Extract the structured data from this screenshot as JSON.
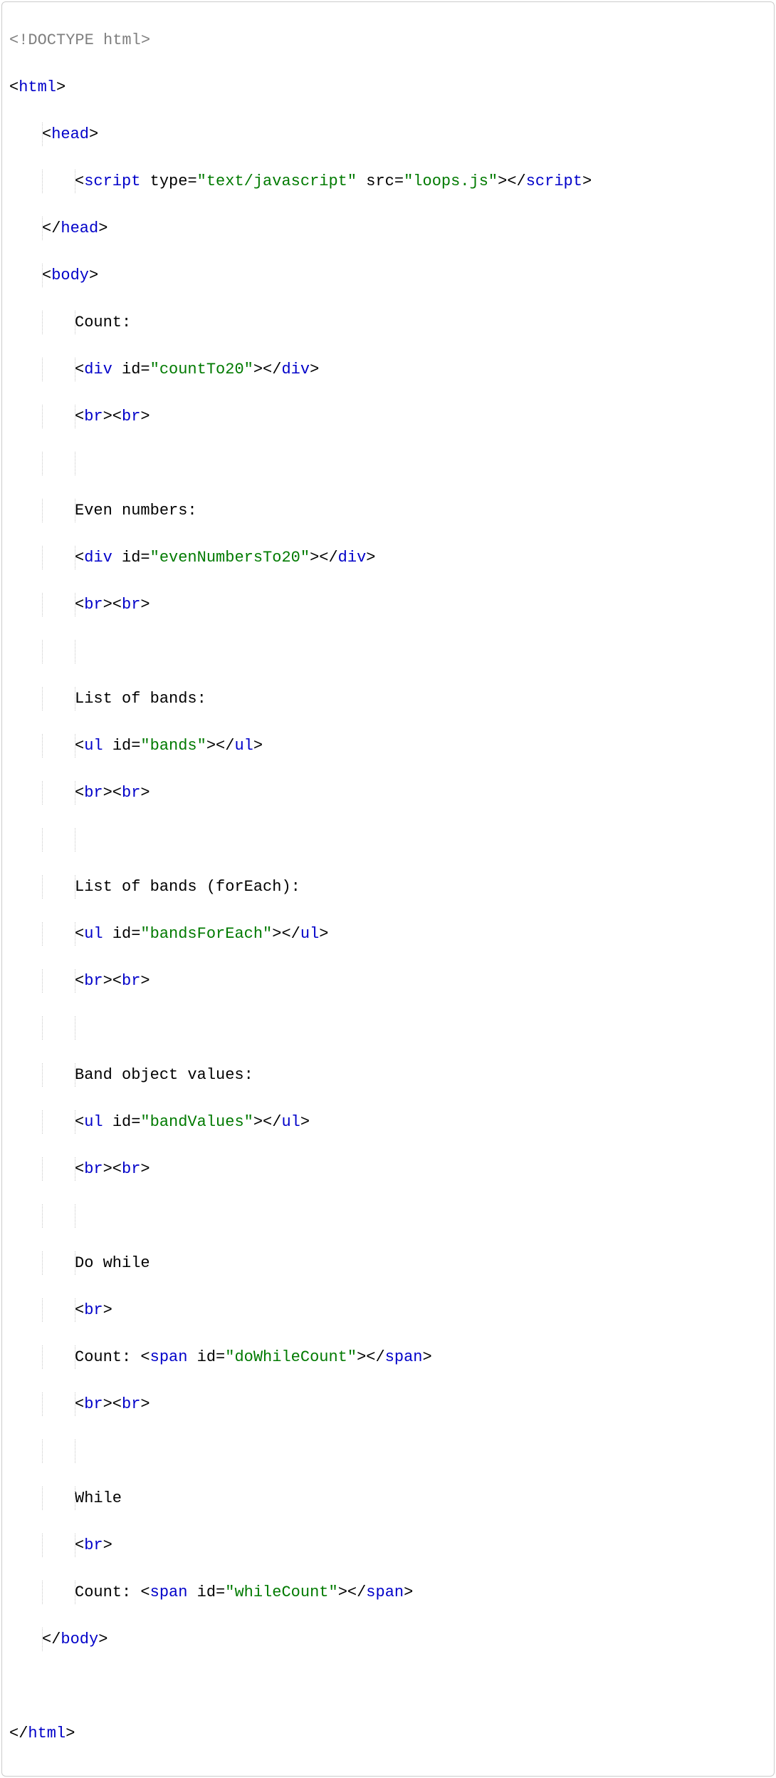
{
  "code": {
    "l00_doctype": "<!DOCTYPE html>",
    "l01_open_html_p1": "<",
    "l01_open_html_tag": "html",
    "l01_open_html_p2": ">",
    "l02_open_head_p1": "<",
    "l02_open_head_tag": "head",
    "l02_open_head_p2": ">",
    "l03_script_p1": "<",
    "l03_script_tag1": "script",
    "l03_script_sp1": " ",
    "l03_script_attr1": "type",
    "l03_script_eq1": "=",
    "l03_script_val1": "\"text/javascript\"",
    "l03_script_sp2": " ",
    "l03_script_attr2": "src",
    "l03_script_eq2": "=",
    "l03_script_val2": "\"loops.js\"",
    "l03_script_p2": "></",
    "l03_script_tag2": "script",
    "l03_script_p3": ">",
    "l04_close_head_p1": "</",
    "l04_close_head_tag": "head",
    "l04_close_head_p2": ">",
    "l05_open_body_p1": "<",
    "l05_open_body_tag": "body",
    "l05_open_body_p2": ">",
    "l06_text": "Count:",
    "l07_p1": "<",
    "l07_tag1": "div",
    "l07_sp1": " ",
    "l07_attr1": "id",
    "l07_eq1": "=",
    "l07_val1": "\"countTo20\"",
    "l07_p2": "></",
    "l07_tag2": "div",
    "l07_p3": ">",
    "l08_p1": "<",
    "l08_tag1": "br",
    "l08_p2": "><",
    "l08_tag2": "br",
    "l08_p3": ">",
    "l10_text": "Even numbers:",
    "l11_p1": "<",
    "l11_tag1": "div",
    "l11_sp1": " ",
    "l11_attr1": "id",
    "l11_eq1": "=",
    "l11_val1": "\"evenNumbersTo20\"",
    "l11_p2": "></",
    "l11_tag2": "div",
    "l11_p3": ">",
    "l12_p1": "<",
    "l12_tag1": "br",
    "l12_p2": "><",
    "l12_tag2": "br",
    "l12_p3": ">",
    "l14_text": "List of bands:",
    "l15_p1": "<",
    "l15_tag1": "ul",
    "l15_sp1": " ",
    "l15_attr1": "id",
    "l15_eq1": "=",
    "l15_val1": "\"bands\"",
    "l15_p2": "></",
    "l15_tag2": "ul",
    "l15_p3": ">",
    "l16_p1": "<",
    "l16_tag1": "br",
    "l16_p2": "><",
    "l16_tag2": "br",
    "l16_p3": ">",
    "l18_text": "List of bands (forEach):",
    "l19_p1": "<",
    "l19_tag1": "ul",
    "l19_sp1": " ",
    "l19_attr1": "id",
    "l19_eq1": "=",
    "l19_val1": "\"bandsForEach\"",
    "l19_p2": "></",
    "l19_tag2": "ul",
    "l19_p3": ">",
    "l20_p1": "<",
    "l20_tag1": "br",
    "l20_p2": "><",
    "l20_tag2": "br",
    "l20_p3": ">",
    "l22_text": "Band object values:",
    "l23_p1": "<",
    "l23_tag1": "ul",
    "l23_sp1": " ",
    "l23_attr1": "id",
    "l23_eq1": "=",
    "l23_val1": "\"bandValues\"",
    "l23_p2": "></",
    "l23_tag2": "ul",
    "l23_p3": ">",
    "l24_p1": "<",
    "l24_tag1": "br",
    "l24_p2": "><",
    "l24_tag2": "br",
    "l24_p3": ">",
    "l26_text": "Do while",
    "l27_p1": "<",
    "l27_tag1": "br",
    "l27_p2": ">",
    "l28_text": "Count: ",
    "l28_p1": "<",
    "l28_tag1": "span",
    "l28_sp1": " ",
    "l28_attr1": "id",
    "l28_eq1": "=",
    "l28_val1": "\"doWhileCount\"",
    "l28_p2": "></",
    "l28_tag2": "span",
    "l28_p3": ">",
    "l29_p1": "<",
    "l29_tag1": "br",
    "l29_p2": "><",
    "l29_tag2": "br",
    "l29_p3": ">",
    "l31_text": "While",
    "l32_p1": "<",
    "l32_tag1": "br",
    "l32_p2": ">",
    "l33_text": "Count: ",
    "l33_p1": "<",
    "l33_tag1": "span",
    "l33_sp1": " ",
    "l33_attr1": "id",
    "l33_eq1": "=",
    "l33_val1": "\"whileCount\"",
    "l33_p2": "></",
    "l33_tag2": "span",
    "l33_p3": ">",
    "l34_close_body_p1": "</",
    "l34_close_body_tag": "body",
    "l34_close_body_p2": ">",
    "l36_close_html_p1": "</",
    "l36_close_html_tag": "html",
    "l36_close_html_p2": ">"
  }
}
